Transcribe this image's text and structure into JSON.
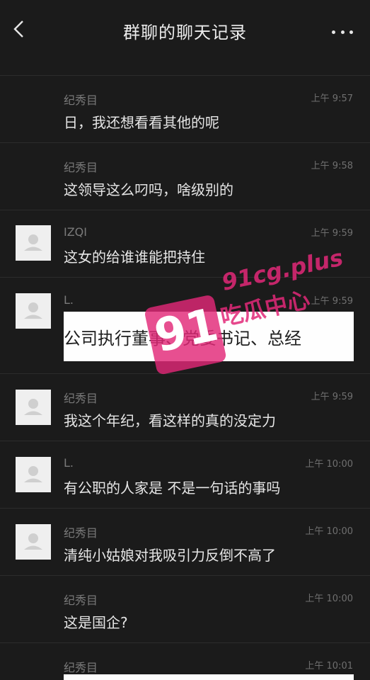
{
  "header": {
    "title": "群聊的聊天记录"
  },
  "messages": [
    {
      "sender": "纪秀目",
      "time": "上午 9:57",
      "text": "日，我还想看看其他的呢"
    },
    {
      "sender": "纪秀目",
      "time": "上午 9:58",
      "text": "这领导这么叼吗，啥级别的"
    },
    {
      "sender": "IZQI",
      "time": "上午 9:59",
      "text": "这女的给谁谁能把持住"
    },
    {
      "sender": "L.",
      "time": "上午 9:59",
      "image_text": "公司执行董事、党委书记、总经"
    },
    {
      "sender": "纪秀目",
      "time": "上午 9:59",
      "text": "我这个年纪，看这样的真的没定力"
    },
    {
      "sender": "L.",
      "time": "上午 10:00",
      "text": "有公职的人家是  不是一句话的事吗"
    },
    {
      "sender": "纪秀目",
      "time": "上午 10:00",
      "text": "清纯小姑娘对我吸引力反倒不高了"
    },
    {
      "sender": "纪秀目",
      "time": "上午 10:00",
      "text": "这是国企?"
    },
    {
      "sender": "纪秀目",
      "time": "上午 10:01"
    }
  ],
  "watermark": {
    "number": "91",
    "domain": "91cg.plus",
    "label": "吃瓜中心"
  },
  "icons": {
    "back": "chevron-left-icon",
    "more": "more-dots-icon",
    "avatar": "default-avatar-icon"
  }
}
